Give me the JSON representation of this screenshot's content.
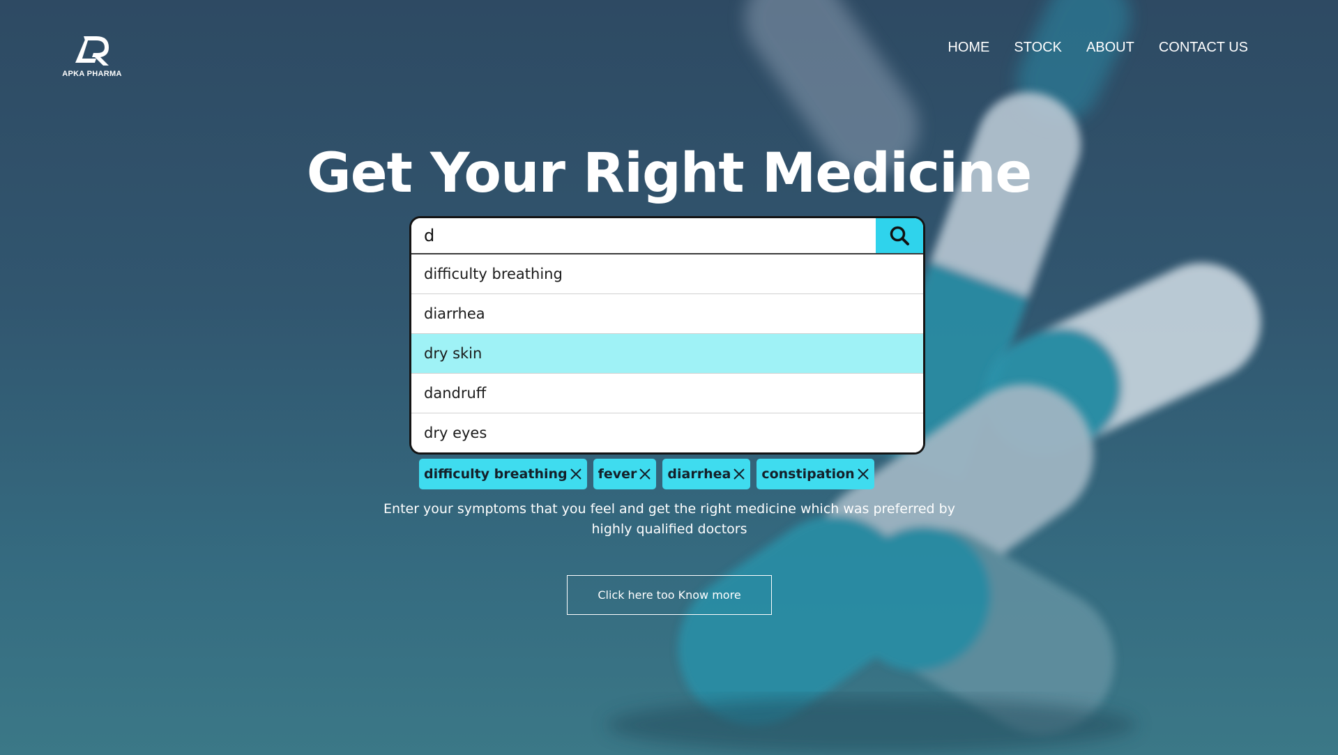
{
  "brand": {
    "name": "APKA PHARMA"
  },
  "nav": {
    "items": [
      {
        "label": "HOME"
      },
      {
        "label": "STOCK"
      },
      {
        "label": "ABOUT"
      },
      {
        "label": "CONTACT US"
      }
    ]
  },
  "hero": {
    "title": "Get Your Right Medicine"
  },
  "search": {
    "value": "d",
    "suggestions": [
      {
        "label": "difficulty breathing",
        "highlighted": false
      },
      {
        "label": "diarrhea",
        "highlighted": false
      },
      {
        "label": "dry skin",
        "highlighted": true
      },
      {
        "label": "dandruff",
        "highlighted": false
      },
      {
        "label": "dry eyes",
        "highlighted": false
      }
    ]
  },
  "tags": [
    {
      "label": "difficulty breathing"
    },
    {
      "label": "fever"
    },
    {
      "label": "diarrhea"
    },
    {
      "label": "constipation"
    }
  ],
  "description": "Enter your symptoms that you feel and get the right medicine which was preferred by highly qualified doctors",
  "cta": {
    "label": "Click here too Know more"
  },
  "icons": {
    "search": "search-icon",
    "remove": "close-icon",
    "logo": "apka-pharma-logo"
  },
  "colors": {
    "accent": "#2fd3ec",
    "tag": "#3fdcef",
    "highlight": "#9ff2f6",
    "background": "#31566f"
  }
}
